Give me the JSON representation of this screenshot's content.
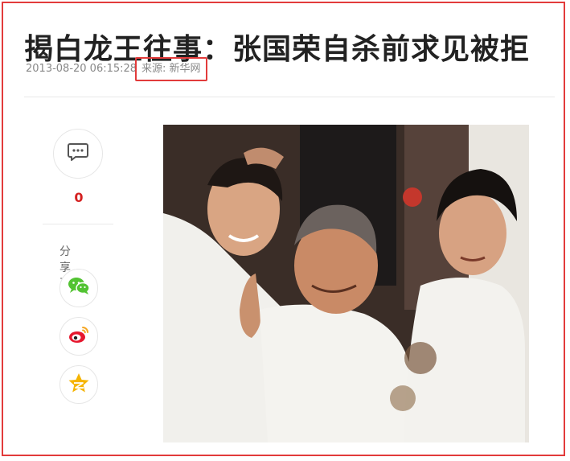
{
  "article": {
    "title": "揭白龙王往事：张国荣自杀前求见被拒",
    "time": "2013-08-20 06:15:28",
    "source": "来源: 新华网"
  },
  "sidebar": {
    "comment_count": "0",
    "share_label": "分享至",
    "share_targets": [
      "wechat",
      "weibo",
      "qzone"
    ]
  },
  "colors": {
    "highlight_border": "#e23b3b",
    "comment_count": "#d42020",
    "wechat": "#52c332",
    "weibo": "#e6162d",
    "qzone": "#f5b400"
  },
  "icons": {
    "comment": "comment-icon",
    "wechat": "wechat-icon",
    "weibo": "weibo-icon",
    "qzone": "qzone-star-icon"
  }
}
